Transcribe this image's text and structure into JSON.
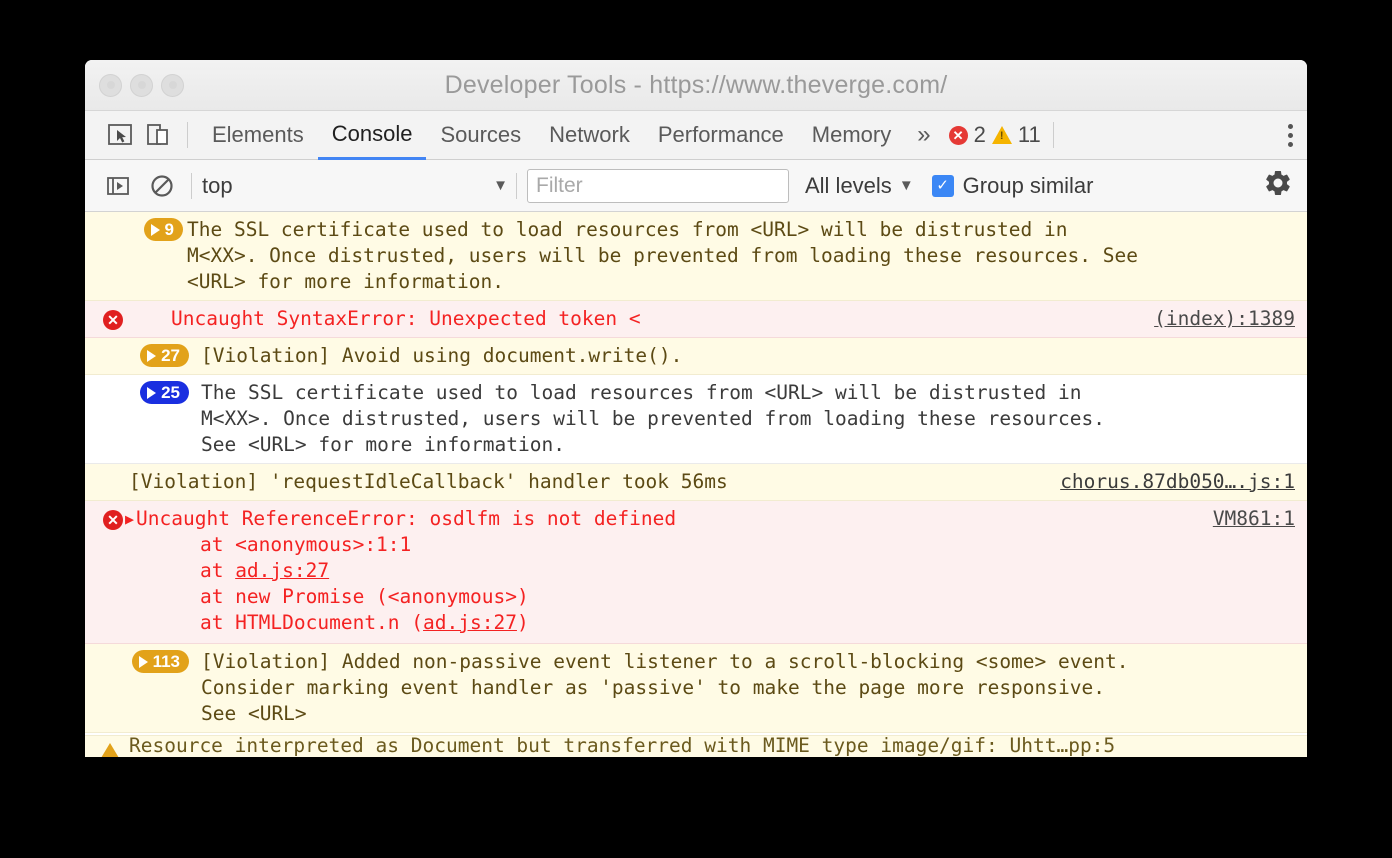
{
  "window": {
    "title": "Developer Tools - https://www.theverge.com/",
    "traffic_lights": [
      "close",
      "minimize",
      "zoom"
    ]
  },
  "tabbar": {
    "inspect_icon": "cursor-select-icon",
    "device_icon": "device-toolbar-icon",
    "tabs": [
      {
        "label": "Elements",
        "active": false
      },
      {
        "label": "Console",
        "active": true
      },
      {
        "label": "Sources",
        "active": false
      },
      {
        "label": "Network",
        "active": false
      },
      {
        "label": "Performance",
        "active": false
      },
      {
        "label": "Memory",
        "active": false
      }
    ],
    "more_tabs": "»",
    "error_count": "2",
    "warning_count": "11",
    "menu_icon": "kebab-menu-icon",
    "accent": "#4285f4",
    "error_color": "#e53935",
    "warning_color": "#f5b400"
  },
  "filterbar": {
    "sidebar_toggle_icon": "console-sidebar-icon",
    "clear_icon": "clear-console-icon",
    "context": "top",
    "context_caret": "▼",
    "filter_placeholder": "Filter",
    "filter_value": "",
    "levels_label": "All levels",
    "levels_caret": "▼",
    "group_similar_label": "Group similar",
    "group_similar_checked": true,
    "checkmark": "✓",
    "settings_icon": "gear-icon",
    "checkbox_color": "#3b87f5"
  },
  "console": {
    "messages": [
      {
        "id": "ssl-warning-group",
        "level": "warn",
        "badge": {
          "count": "9",
          "color": "orange"
        },
        "text": "The SSL certificate used to load resources from <URL> will be distrusted in\nM<XX>. Once distrusted, users will be prevented from loading these resources. See\n<URL> for more information.",
        "source": ""
      },
      {
        "id": "syntax-error",
        "level": "err",
        "icon": "error-circle-icon",
        "text": "Uncaught SyntaxError: Unexpected token <",
        "source": "(index):1389"
      },
      {
        "id": "document-write-violation",
        "level": "warn",
        "badge": {
          "count": "27",
          "color": "orange"
        },
        "text": "[Violation] Avoid using document.write().",
        "source": ""
      },
      {
        "id": "ssl-info-group",
        "level": "info",
        "badge": {
          "count": "25",
          "color": "blue"
        },
        "text": "The SSL certificate used to load resources from <URL> will be distrusted in\nM<XX>. Once distrusted, users will be prevented from loading these resources.\nSee <URL> for more information.",
        "source": ""
      },
      {
        "id": "requestidlecallback-violation",
        "level": "warn",
        "text": "[Violation] 'requestIdleCallback' handler took 56ms",
        "source": "chorus.87db050….js:1"
      },
      {
        "id": "reference-error",
        "level": "err",
        "icon": "error-circle-icon",
        "disclosure": "▶",
        "text": "Uncaught ReferenceError: osdlfm is not defined",
        "stack": [
          {
            "prefix": "    at <anonymous>:1:1",
            "link": "",
            "suffix": ""
          },
          {
            "prefix": "    at ",
            "link": "ad.js:27",
            "suffix": ""
          },
          {
            "prefix": "    at new Promise (<anonymous>)",
            "link": "",
            "suffix": ""
          },
          {
            "prefix": "    at HTMLDocument.n (",
            "link": "ad.js:27",
            "suffix": ")"
          }
        ],
        "source": "VM861:1"
      },
      {
        "id": "passive-listener-violation",
        "level": "warn",
        "badge": {
          "count": "113",
          "color": "orange"
        },
        "text": "[Violation] Added non-passive event listener to a scroll-blocking <some> event.\nConsider marking event handler as 'passive' to make the page more responsive.\nSee <URL>",
        "source": ""
      }
    ],
    "clipped_row": {
      "id": "mime-type-warning",
      "icon": "warning-triangle-icon",
      "text": "Resource interpreted as Document but transferred with MIME type image/gif: Uhtt…pp:5"
    }
  }
}
